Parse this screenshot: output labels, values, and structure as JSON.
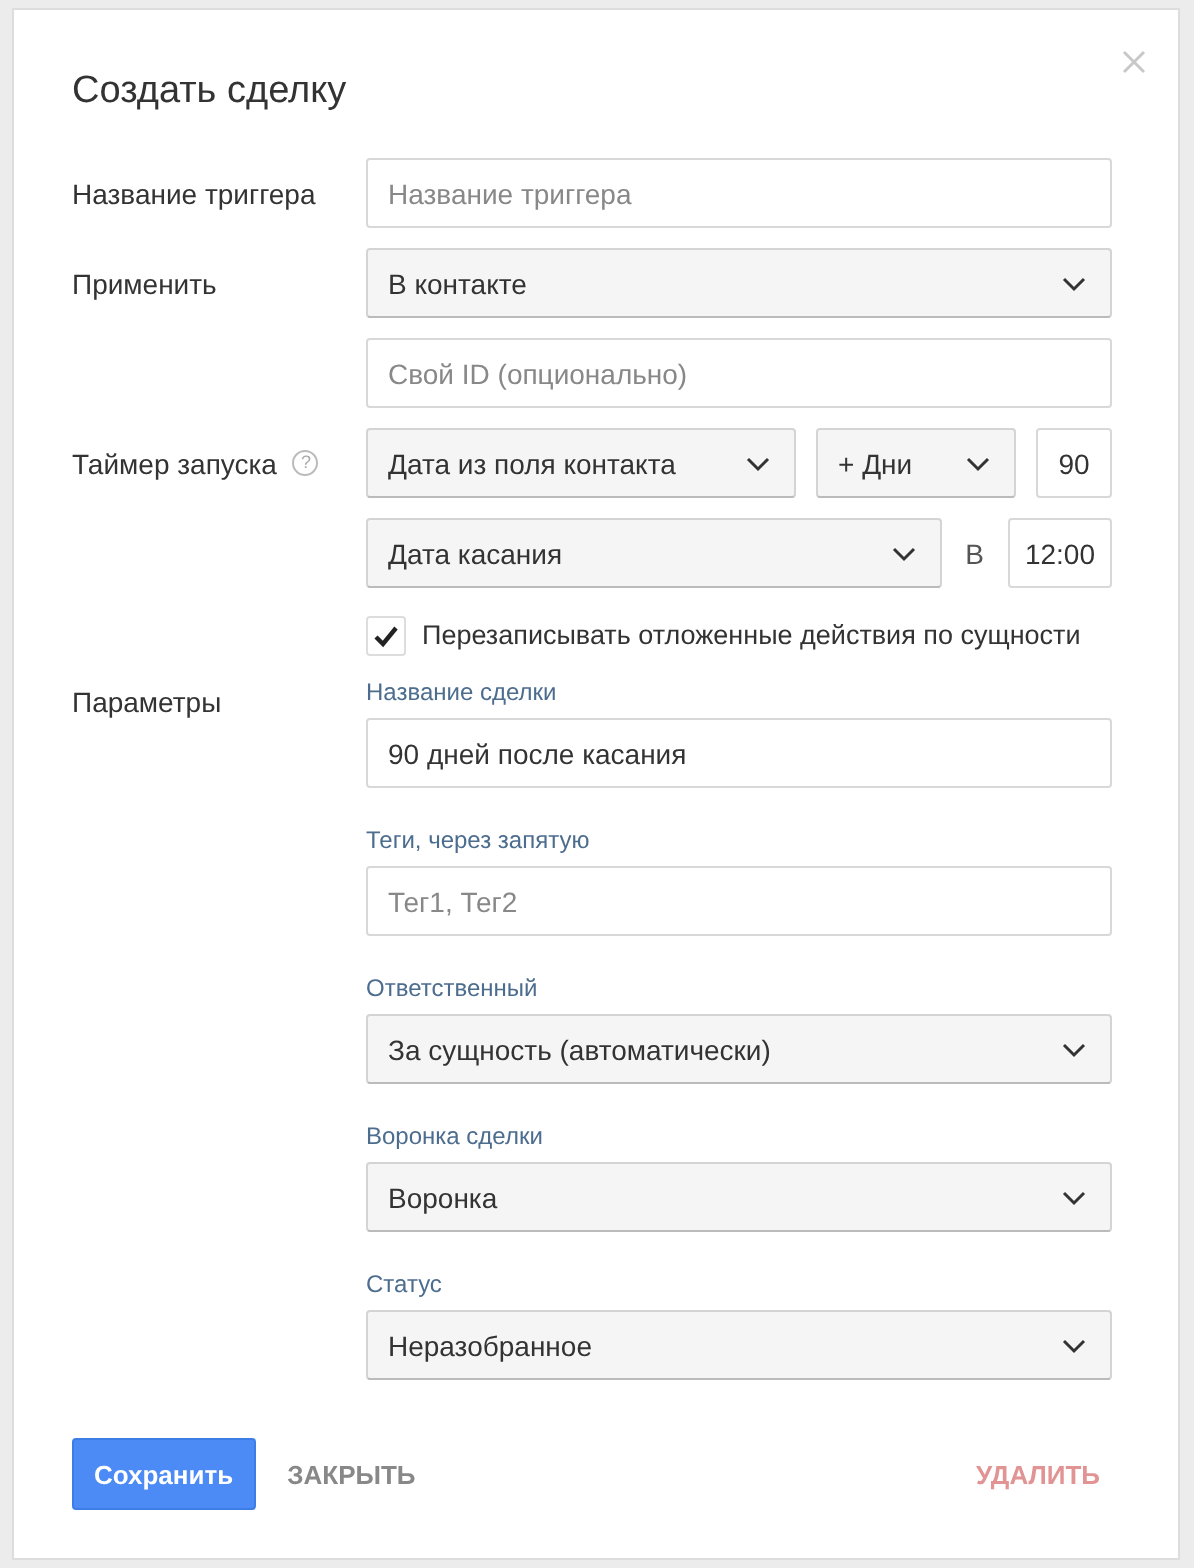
{
  "dialog": {
    "title": "Создать сделку"
  },
  "trigger": {
    "label": "Название триггера",
    "placeholder": "Название триггера"
  },
  "apply": {
    "label": "Применить",
    "value": "В контакте",
    "id_placeholder": "Свой ID (опционально)"
  },
  "timer": {
    "label": "Таймер запуска",
    "help": "?",
    "date_source": "Дата из поля контакта",
    "offset_unit": "+ Дни",
    "offset_value": "90",
    "date_field": "Дата касания",
    "at_label": "В",
    "time": "12:00"
  },
  "overwrite": {
    "label": "Перезаписывать отложенные действия по сущности",
    "checked": true
  },
  "params": {
    "label": "Параметры",
    "fields": [
      {
        "kind": "text",
        "label": "Название сделки",
        "value": "90 дней после касания"
      },
      {
        "kind": "text",
        "label": "Теги, через запятую",
        "placeholder": "Тег1, Тег2"
      },
      {
        "kind": "select",
        "label": "Ответственный",
        "value": "За сущность (автоматически)"
      },
      {
        "kind": "select",
        "label": "Воронка сделки",
        "value": "Воронка"
      },
      {
        "kind": "select",
        "label": "Статус",
        "value": "Неразобранное"
      }
    ]
  },
  "buttons": {
    "save": "Сохранить",
    "close": "ЗАКРЫТЬ",
    "delete": "УДАЛИТЬ"
  }
}
